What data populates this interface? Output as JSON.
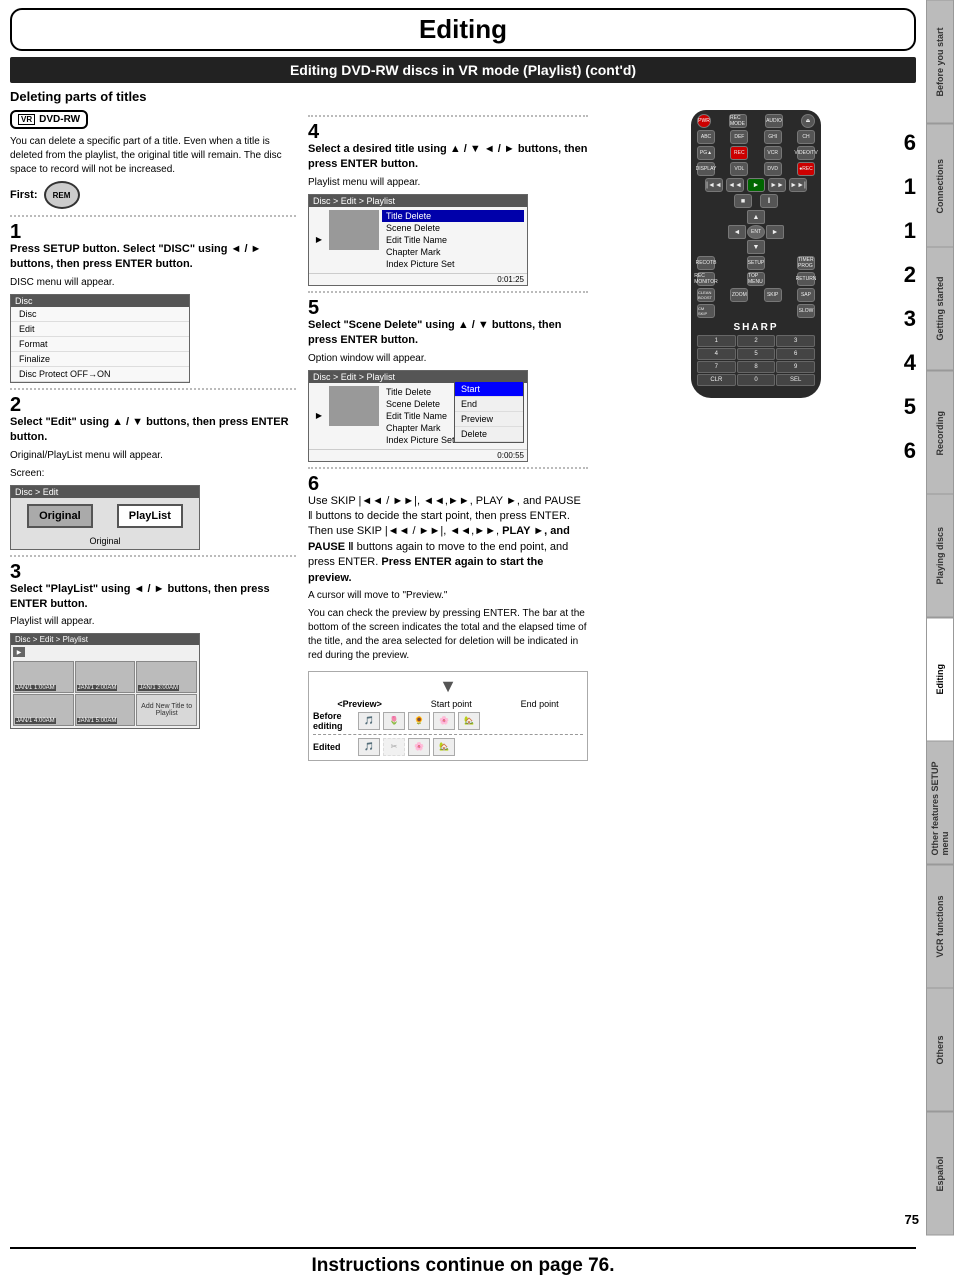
{
  "page": {
    "title": "Editing",
    "subtitle": "Editing DVD-RW discs in VR mode (Playlist) (cont'd)",
    "section_heading": "Deleting parts of titles",
    "page_number": "75",
    "bottom_instruction": "Instructions continue on page 76."
  },
  "sidebar": {
    "tabs": [
      {
        "label": "Before you start",
        "active": false
      },
      {
        "label": "Connections",
        "active": false
      },
      {
        "label": "Getting started",
        "active": false
      },
      {
        "label": "Recording",
        "active": false
      },
      {
        "label": "Playing discs",
        "active": false
      },
      {
        "label": "Editing",
        "active": true
      },
      {
        "label": "Other features SETUP menu",
        "active": false
      },
      {
        "label": "VCR functions",
        "active": false
      },
      {
        "label": "Others",
        "active": false
      },
      {
        "label": "Español",
        "active": false
      }
    ]
  },
  "intro_text": "You can delete a specific part of a title. Even when a title is deleted from the playlist, the original title will remain. The disc space to record will not be increased.",
  "first_label": "First:",
  "steps": {
    "step1": {
      "num": "1",
      "instruction": "Press SETUP button. Select \"DISC\" using ◄ / ► buttons, then press ENTER button.",
      "result": "DISC menu will appear.",
      "screen": {
        "header": "Disc",
        "items": [
          "Disc",
          "Edit",
          "Format",
          "Finalize",
          "Disc Protect OFF→ON"
        ]
      }
    },
    "step2": {
      "num": "2",
      "instruction": "Select \"Edit\" using ▲ / ▼ buttons, then press ENTER button.",
      "result": "Original/PlayList menu will appear.",
      "screen_label": "Screen:",
      "screen": {
        "header": "Disc > Edit",
        "left_btn": "Original",
        "right_btn": "PlayList",
        "bottom_label": "Original"
      }
    },
    "step3": {
      "num": "3",
      "instruction": "Select \"PlayList\" using ◄ / ► buttons, then press ENTER button.",
      "result": "Playlist will appear.",
      "screen": {
        "header": "Disc > Edit > Playlist",
        "thumbs": [
          {
            "time": "JAN/1  1:00AM",
            "label": "thumb1"
          },
          {
            "time": "JAN/1  2:00AM",
            "label": "thumb2"
          },
          {
            "time": "JAN/1  3:00AM",
            "label": "thumb3"
          },
          {
            "time": "JAN/1  4:00AM",
            "label": "thumb4"
          },
          {
            "time": "JAN/1  5:00AM",
            "label": "thumb5"
          },
          {
            "label": "Add New Title to Playlist",
            "is_add": true
          }
        ]
      }
    },
    "step4": {
      "num": "4",
      "instruction": "Select a desired title using ▲ / ▼ ◄ / ► buttons, then press ENTER button.",
      "result": "Playlist menu will appear.",
      "screen": {
        "header": "Disc > Edit > Playlist",
        "menu_items": [
          "Title Delete",
          "Scene Delete",
          "Edit Title Name",
          "Chapter Mark",
          "Index Picture Set"
        ],
        "menu_highlight": "Title Delete",
        "timestamp": "0:01:25"
      }
    },
    "step5": {
      "num": "5",
      "instruction": "Select \"Scene Delete\" using ▲ / ▼ buttons, then press ENTER button.",
      "result": "Option window will appear.",
      "screen": {
        "header": "Disc > Edit > Playlist",
        "menu_items": [
          "Title Delete",
          "Scene Delete",
          "Edit Title Name",
          "Chapter Mark",
          "Index Picture Set"
        ],
        "popup_items": [
          "Start",
          "End",
          "Preview",
          "Delete"
        ],
        "popup_highlight": "Start",
        "timestamp": "0:00:55"
      }
    },
    "step6": {
      "num": "6",
      "instruction": "Use SKIP |◄◄ / ►►|, ◄◄,►►, PLAY ►, and PAUSE ‖ buttons to decide the start point, then press ENTER. Then use SKIP |◄◄ / ►►|, ◄◄,►►, PLAY ►, and PAUSE ‖ buttons again to move to the end point, and press ENTER. Press ENTER again to start the preview.",
      "note": "A cursor will move to \"Preview.\"",
      "extra_text": "You can check the preview by pressing ENTER. The bar at the bottom of the screen indicates the total and the elapsed time of the title, and the area selected for deletion will be indicated in red during the preview."
    }
  },
  "remote": {
    "step_labels_right": [
      "6",
      "1",
      "1",
      "2",
      "3",
      "4",
      "5",
      "6"
    ]
  },
  "preview": {
    "title": "<Preview>",
    "start_label": "Start point",
    "end_label": "End point",
    "before_label": "Before editing",
    "after_label": "Edited"
  }
}
